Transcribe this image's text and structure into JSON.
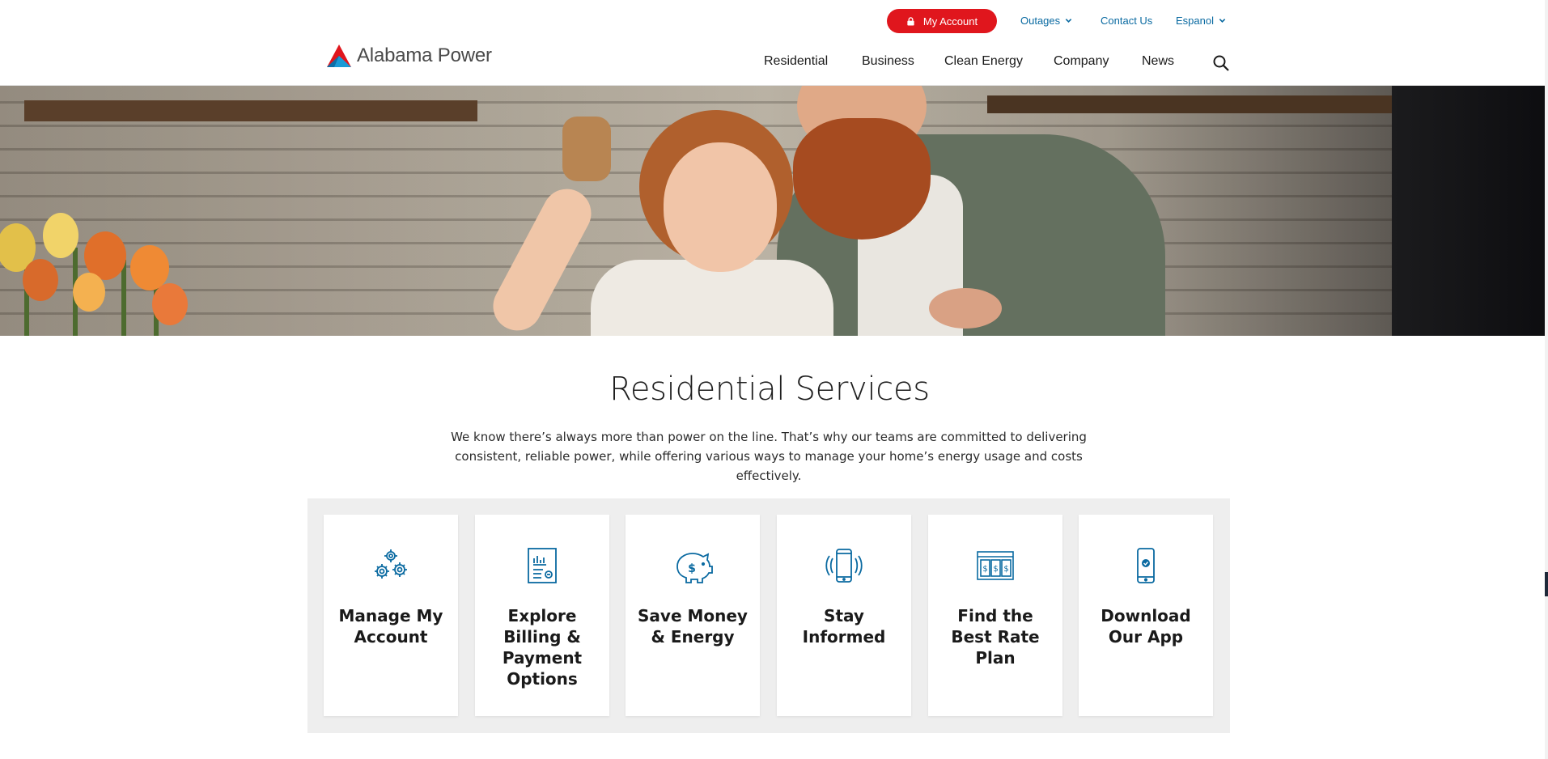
{
  "utility_bar": {
    "my_account_label": "My Account",
    "outages_label": "Outages",
    "contact_label": "Contact Us",
    "language_label": "Espanol"
  },
  "brand": {
    "name": "Alabama Power"
  },
  "nav": {
    "items": [
      "Residential",
      "Business",
      "Clean Energy",
      "Company",
      "News"
    ]
  },
  "main": {
    "title": "Residential Services",
    "intro": "We know there’s always more than power on the line. That’s why our teams are committed to delivering consistent, reliable power, while offering various ways to manage your home’s energy usage and costs effectively."
  },
  "cards": [
    {
      "label": "Manage My Account",
      "icon": "gears-icon"
    },
    {
      "label": "Explore Billing & Payment Options",
      "icon": "bill-document-icon"
    },
    {
      "label": "Save Money & Energy",
      "icon": "piggy-bank-icon"
    },
    {
      "label": "Stay Informed",
      "icon": "phone-vibrate-icon"
    },
    {
      "label": "Find the Best Rate Plan",
      "icon": "rate-plan-icon"
    },
    {
      "label": "Download Our App",
      "icon": "mobile-app-icon"
    }
  ],
  "colors": {
    "accent_red": "#e0161d",
    "link_blue": "#0a6aa1",
    "icon_blue": "#0a6aa1",
    "card_background": "#eeeeee"
  }
}
